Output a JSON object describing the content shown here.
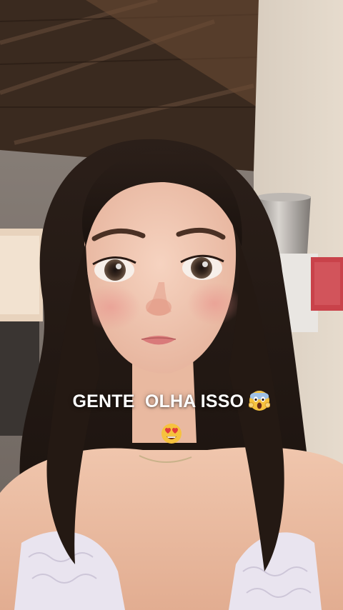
{
  "story": {
    "caption": {
      "line1": "GENTE  OLHA ISSO",
      "emoji1": "scream-emoji",
      "emoji2": "heart-eyes-emoji"
    }
  },
  "colors": {
    "caption_text": "#ffffff",
    "ceiling_wood": "#3a2a1f",
    "wall": "#cfc3b6",
    "hair": "#2a1e18",
    "skin": "#f2c9b3"
  }
}
